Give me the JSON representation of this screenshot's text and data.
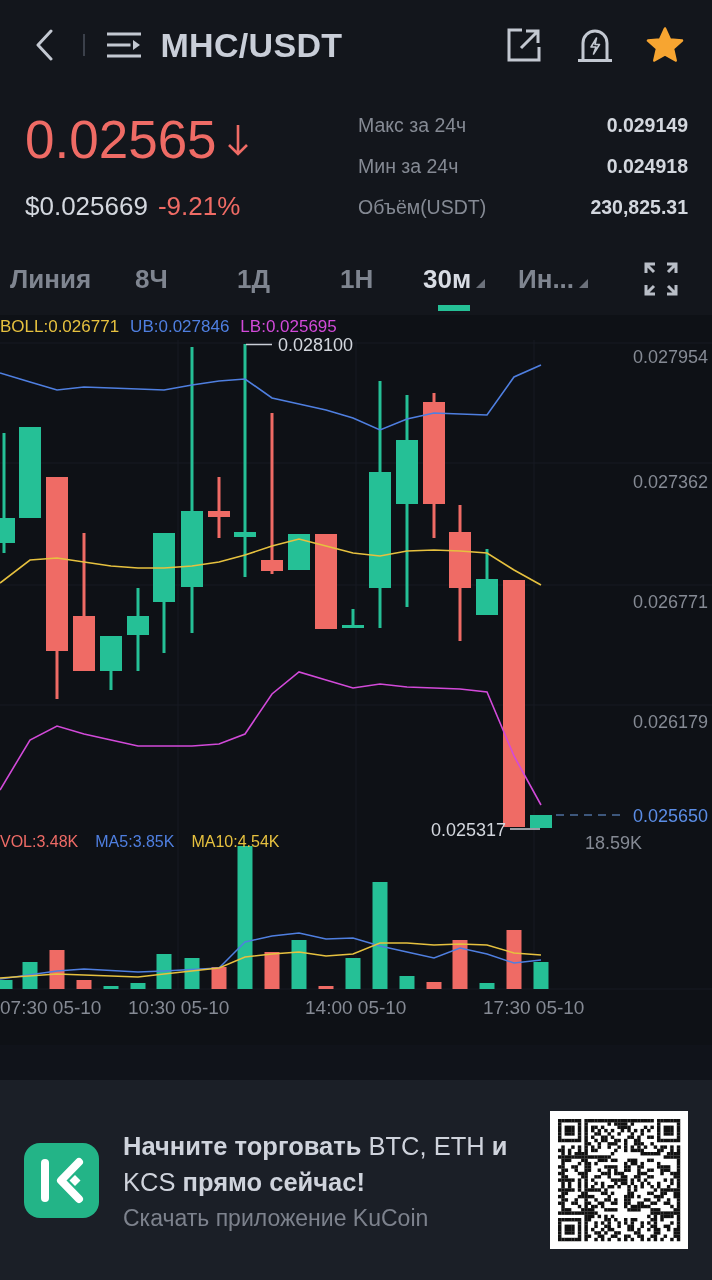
{
  "header": {
    "title": "MHC/USDT",
    "favorite": true
  },
  "ticker": {
    "price": "0.02565",
    "falling": true,
    "fiat_price": "$0.025669",
    "change": "-9.21%"
  },
  "stats": [
    {
      "label": "Макс за 24ч",
      "value": "0.029149"
    },
    {
      "label": "Мин за 24ч",
      "value": "0.024918"
    },
    {
      "label": "Объём(USDT)",
      "value": "230,825.31"
    }
  ],
  "intervals": [
    {
      "label": "Линия",
      "selected": false,
      "dropdown": false
    },
    {
      "label": "8Ч",
      "selected": false,
      "dropdown": false
    },
    {
      "label": "1Д",
      "selected": false,
      "dropdown": false
    },
    {
      "label": "1Н",
      "selected": false,
      "dropdown": false
    },
    {
      "label": "30м",
      "selected": true,
      "dropdown": true
    },
    {
      "label": "Ин...",
      "selected": false,
      "dropdown": true
    }
  ],
  "price_chart": {
    "legend": [
      {
        "text": "BOLL:0.026771",
        "color": "#e6c13f"
      },
      {
        "text": "UB:0.027846",
        "color": "#4f7fe0"
      },
      {
        "text": "LB:0.025695",
        "color": "#d24ad9"
      }
    ],
    "axis_labels": [
      "0.027954",
      "0.027362",
      "0.026771",
      "0.026179"
    ],
    "high_label": "0.028100",
    "low_label": "0.025317",
    "last_price_label": "0.025650"
  },
  "volume_chart": {
    "legend": [
      {
        "text": "VOL:3.48K",
        "color": "#ee6b66"
      },
      {
        "text": "MA5:3.85K",
        "color": "#4f7fe0"
      },
      {
        "text": "MA10:4.54K",
        "color": "#e6c13f"
      }
    ],
    "max_label": "18.59K",
    "time_labels": [
      "07:30 05-10",
      "10:30 05-10",
      "14:00 05-10",
      "17:30 05-10"
    ]
  },
  "banner": {
    "headline": "**Начните торговать** BTC, ETH **и** KCS **прямо сейчас!**",
    "subtitle": "Скачать приложение KuCoin"
  }
}
